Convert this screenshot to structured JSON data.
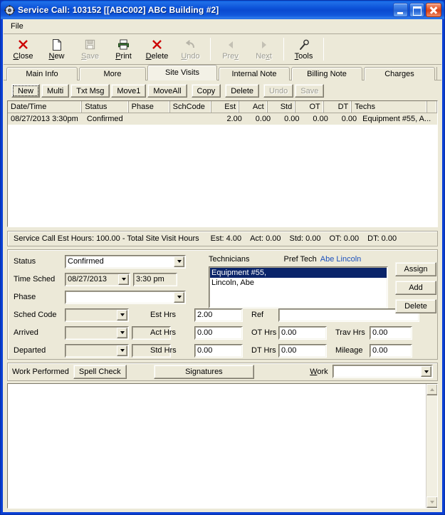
{
  "window": {
    "title": "Service Call: 103152 [[ABC002] ABC Building #2]",
    "icon": "gear-icon",
    "minimize": "_",
    "maximize": "□",
    "close": "×"
  },
  "menubar": {
    "items": [
      {
        "label": "File"
      }
    ]
  },
  "toolbar": {
    "items": [
      {
        "label": "Close",
        "icon": "red-x-icon",
        "disabled": false,
        "accel": "C"
      },
      {
        "label": "New",
        "icon": "page-icon",
        "disabled": false,
        "accel": "N"
      },
      {
        "label": "Save",
        "icon": "floppy-icon",
        "disabled": true,
        "accel": "S"
      },
      {
        "label": "Print",
        "icon": "printer-icon",
        "disabled": false,
        "accel": "P"
      },
      {
        "label": "Delete",
        "icon": "red-x-icon",
        "disabled": false,
        "accel": "D"
      },
      {
        "label": "Undo",
        "icon": "undo-arrow-icon",
        "disabled": true,
        "accel": "U"
      },
      {
        "label": "Prev",
        "icon": "left-arrow-icon",
        "disabled": true,
        "accel": "v"
      },
      {
        "label": "Next",
        "icon": "right-arrow-icon",
        "disabled": true,
        "accel": "x"
      },
      {
        "label": "Tools",
        "icon": "wrench-icon",
        "disabled": false,
        "accel": "T"
      }
    ]
  },
  "tabs": [
    {
      "label": "Main Info",
      "active": false
    },
    {
      "label": "More",
      "active": false
    },
    {
      "label": "Site Visits",
      "active": true
    },
    {
      "label": "Internal Note",
      "active": false
    },
    {
      "label": "Billing Note",
      "active": false
    },
    {
      "label": "Charges",
      "active": false
    }
  ],
  "grid_buttons": [
    {
      "label": "New",
      "disabled": false,
      "focused": true
    },
    {
      "label": "Multi",
      "disabled": false,
      "focused": false
    },
    {
      "label": "Txt Msg",
      "disabled": false,
      "focused": false
    },
    {
      "label": "Move1",
      "disabled": false,
      "focused": false
    },
    {
      "label": "MoveAll",
      "disabled": false,
      "focused": false
    },
    {
      "label": "Copy",
      "disabled": false,
      "focused": false
    },
    {
      "label": "Delete",
      "disabled": false,
      "focused": false
    },
    {
      "label": "Undo",
      "disabled": true,
      "focused": false
    },
    {
      "label": "Save",
      "disabled": true,
      "focused": false
    }
  ],
  "grid": {
    "columns": [
      {
        "label": "Date/Time",
        "align": "left"
      },
      {
        "label": "Status",
        "align": "left"
      },
      {
        "label": "Phase",
        "align": "left"
      },
      {
        "label": "SchCode",
        "align": "left"
      },
      {
        "label": "Est",
        "align": "right"
      },
      {
        "label": "Act",
        "align": "right"
      },
      {
        "label": "Std",
        "align": "right"
      },
      {
        "label": "OT",
        "align": "right"
      },
      {
        "label": "DT",
        "align": "right"
      },
      {
        "label": "Techs",
        "align": "left"
      }
    ],
    "rows": [
      {
        "date_time": "08/27/2013 3:30pm",
        "status": "Confirmed",
        "phase": "",
        "schcode": "",
        "est": "2.00",
        "act": "0.00",
        "std": "0.00",
        "ot": "0.00",
        "dt": "0.00",
        "techs": "Equipment #55, A..."
      }
    ]
  },
  "summary": {
    "est_hours_label": "Service Call Est Hours: 100.00  -  Total Site Visit Hours",
    "est": "Est: 4.00",
    "act": "Act: 0.00",
    "std": "Std: 0.00",
    "ot": "OT: 0.00",
    "dt": "DT: 0.00"
  },
  "detail": {
    "status": {
      "label": "Status",
      "value": "Confirmed"
    },
    "time_sched": {
      "label": "Time Sched",
      "date": "08/27/2013",
      "time": "3:30 pm"
    },
    "phase": {
      "label": "Phase",
      "value": ""
    },
    "sched_code": {
      "label": "Sched Code",
      "value": ""
    },
    "arrived": {
      "label": "Arrived",
      "value": "",
      "extra": ""
    },
    "departed": {
      "label": "Departed",
      "value": "",
      "extra": ""
    },
    "est_hrs": {
      "label": "Est Hrs",
      "value": "2.00"
    },
    "act_hrs": {
      "label": "Act Hrs",
      "value": "0.00"
    },
    "std_hrs": {
      "label": "Std Hrs",
      "value": "0.00"
    },
    "ref": {
      "label": "Ref",
      "value": ""
    },
    "ot_hrs": {
      "label": "OT Hrs",
      "value": "0.00"
    },
    "dt_hrs": {
      "label": "DT Hrs",
      "value": "0.00"
    },
    "trav_hrs": {
      "label": "Trav Hrs",
      "value": "0.00"
    },
    "mileage": {
      "label": "Mileage",
      "value": "0.00"
    },
    "technicians": {
      "label": "Technicians",
      "pref_tech_label": "Pref Tech",
      "pref_tech_name": "Abe Lincoln",
      "pref_tech_color": "#1a4fbd",
      "items": [
        {
          "name": "Equipment #55,",
          "selected": true
        },
        {
          "name": "Lincoln, Abe",
          "selected": false
        }
      ],
      "selection_color": "#0a246a",
      "buttons": [
        {
          "label": "Assign"
        },
        {
          "label": "Add"
        },
        {
          "label": "Delete"
        }
      ]
    }
  },
  "work": {
    "performed_label": "Work Performed",
    "spell_check_label": "Spell Check",
    "signatures_label": "Signatures",
    "work_label": "Work",
    "work_value": "",
    "notes_value": ""
  }
}
